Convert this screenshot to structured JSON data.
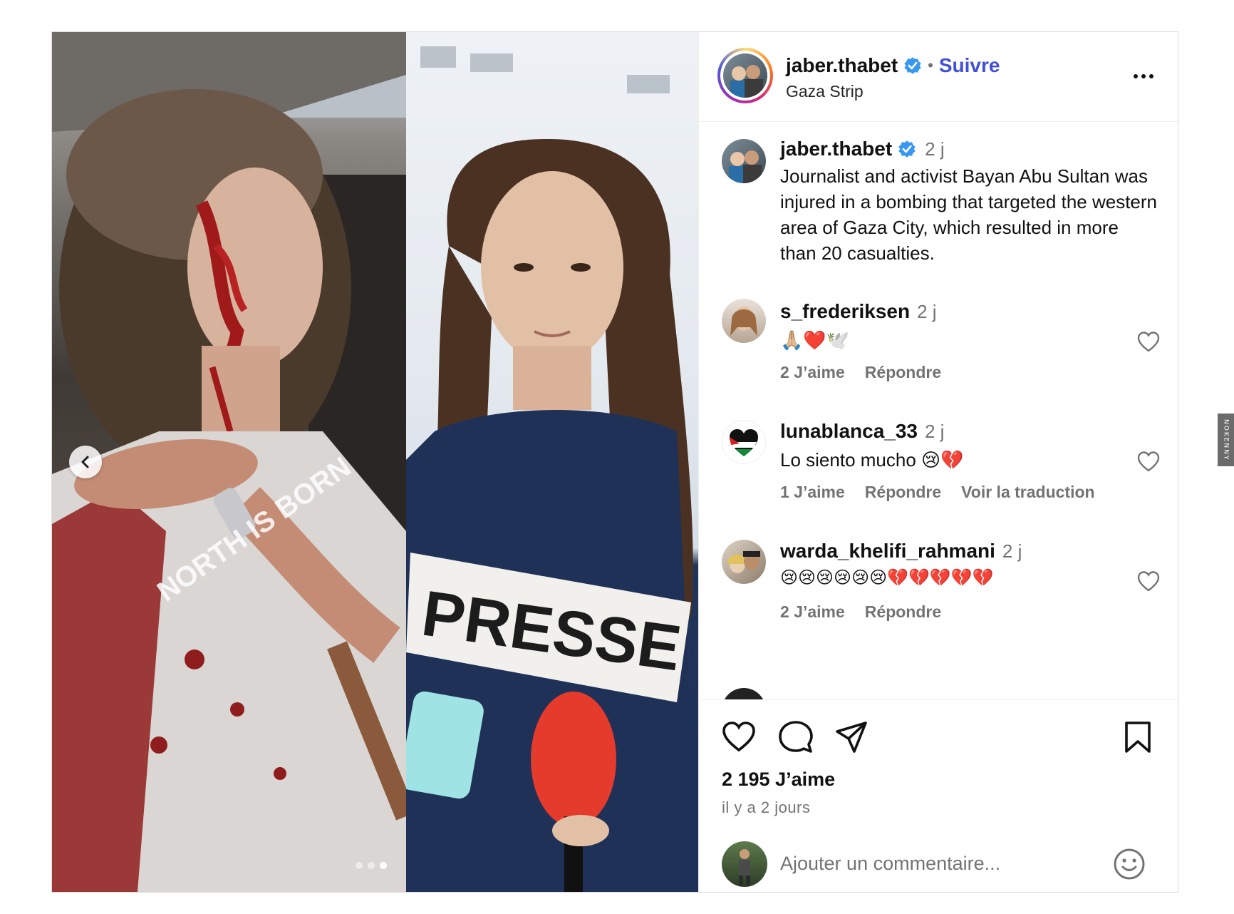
{
  "header": {
    "username": "jaber.thabet",
    "separator": "•",
    "follow_label": "Suivre",
    "location": "Gaza Strip"
  },
  "caption": {
    "username": "jaber.thabet",
    "time": "2 j",
    "text": "Journalist and activist Bayan Abu Sultan was injured in a bombing that targeted the western area of Gaza City, which resulted in more than 20 casualties."
  },
  "media": {
    "left_photo_shirt_text": "NORTH IS BORN",
    "right_photo_vest_text": "PRESSE",
    "carousel_total": 3,
    "carousel_active": 3
  },
  "comments": [
    {
      "username": "s_frederiksen",
      "time": "2 j",
      "text": "🙏🏼❤️🕊️",
      "likes": "2 J’aime",
      "reply": "Répondre",
      "translate": ""
    },
    {
      "username": "lunablanca_33",
      "time": "2 j",
      "text": "Lo siento mucho 😢💔",
      "likes": "1 J’aime",
      "reply": "Répondre",
      "translate": "Voir la traduction"
    },
    {
      "username": "warda_khelifi_rahmani",
      "time": "2 j",
      "text": "😢😢😢😢😢😢💔💔💔💔💔",
      "likes": "2 J’aime",
      "reply": "Répondre",
      "translate": ""
    }
  ],
  "footer": {
    "likes_count": "2 195 J’aime",
    "posted": "il y a 2 jours",
    "comment_placeholder": "Ajouter un commentaire..."
  },
  "watermark": "NOKENNY",
  "colors": {
    "accent_link": "#4150d8",
    "verified_blue": "#3897f0",
    "muted": "#737373",
    "border": "#dbdbdb"
  },
  "icons": {
    "like": "heart-icon",
    "comment": "speech-bubble-icon",
    "share": "paper-plane-icon",
    "save": "bookmark-icon",
    "more": "ellipsis-icon",
    "emoji": "smiley-icon",
    "prev": "chevron-left-icon"
  }
}
